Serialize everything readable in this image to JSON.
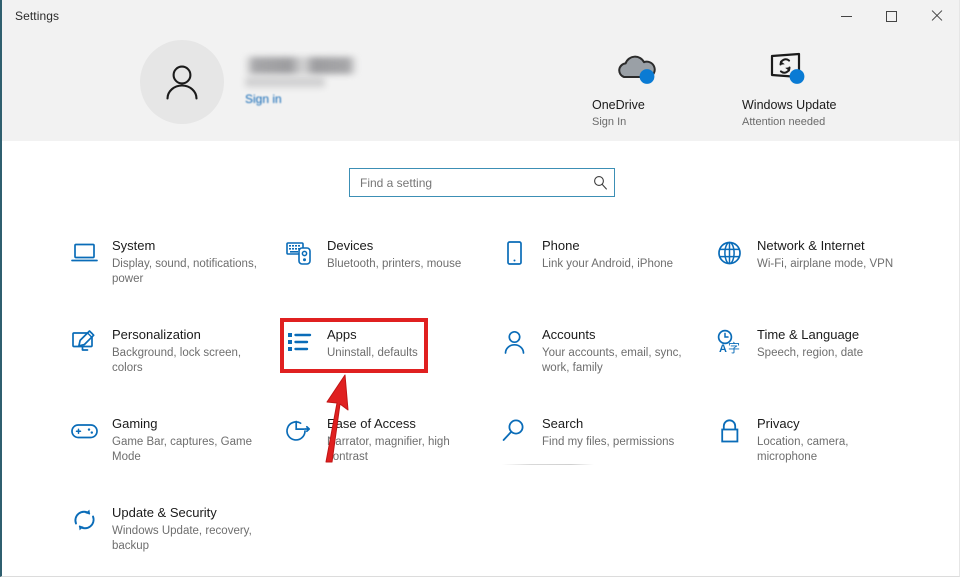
{
  "window": {
    "title": "Settings",
    "controls": {
      "minimize": "Minimize",
      "maximize": "Maximize",
      "close": "Close"
    }
  },
  "header": {
    "account": {
      "name": "",
      "signin_label": "Sign in",
      "avatar_icon": "person-icon"
    },
    "quick_items": [
      {
        "title": "OneDrive",
        "subtitle": "Sign In",
        "icon": "onedrive-cloud-icon",
        "badge_color": "#0a7bd4"
      },
      {
        "title": "Windows Update",
        "subtitle": "Attention needed",
        "icon": "windows-update-icon",
        "badge_color": "#0a7bd4"
      }
    ]
  },
  "search": {
    "placeholder": "Find a setting",
    "value": "",
    "icon": "search-icon",
    "border_color": "#3c8fb5"
  },
  "categories": [
    {
      "title": "System",
      "subtitle": "Display, sound, notifications, power",
      "icon": "laptop-icon"
    },
    {
      "title": "Devices",
      "subtitle": "Bluetooth, printers, mouse",
      "icon": "keyboard-mouse-icon"
    },
    {
      "title": "Phone",
      "subtitle": "Link your Android, iPhone",
      "icon": "phone-icon"
    },
    {
      "title": "Network & Internet",
      "subtitle": "Wi-Fi, airplane mode, VPN",
      "icon": "globe-icon"
    },
    {
      "title": "Personalization",
      "subtitle": "Background, lock screen, colors",
      "icon": "paintbrush-monitor-icon"
    },
    {
      "title": "Apps",
      "subtitle": "Uninstall, defaults",
      "icon": "app-list-icon"
    },
    {
      "title": "Accounts",
      "subtitle": "Your accounts, email, sync, work, family",
      "icon": "person-icon"
    },
    {
      "title": "Time & Language",
      "subtitle": "Speech, region, date",
      "icon": "clock-language-icon"
    },
    {
      "title": "Gaming",
      "subtitle": "Game Bar, captures, Game Mode",
      "icon": "gamepad-icon"
    },
    {
      "title": "Ease of Access",
      "subtitle": "Narrator, magnifier, high contrast",
      "icon": "ease-of-access-icon"
    },
    {
      "title": "Search",
      "subtitle": "Find my files, permissions",
      "icon": "magnifier-icon"
    },
    {
      "title": "Privacy",
      "subtitle": "Location, camera, microphone",
      "icon": "lock-icon"
    },
    {
      "title": "Update & Security",
      "subtitle": "Windows Update, recovery, backup",
      "icon": "refresh-shield-icon"
    }
  ],
  "annotations": {
    "highlight_color": "#e02020",
    "highlight_target": "Apps",
    "arrow_color": "#e02020",
    "arrow_points_to": "Apps"
  },
  "colors": {
    "accent_blue": "#0a7bd4",
    "icon_blue": "#0a6cb8",
    "header_bg": "#f2f2f2",
    "body_bg": "#ffffff",
    "title_text": "#1b1b1b",
    "sub_text": "#6e6e6e"
  }
}
